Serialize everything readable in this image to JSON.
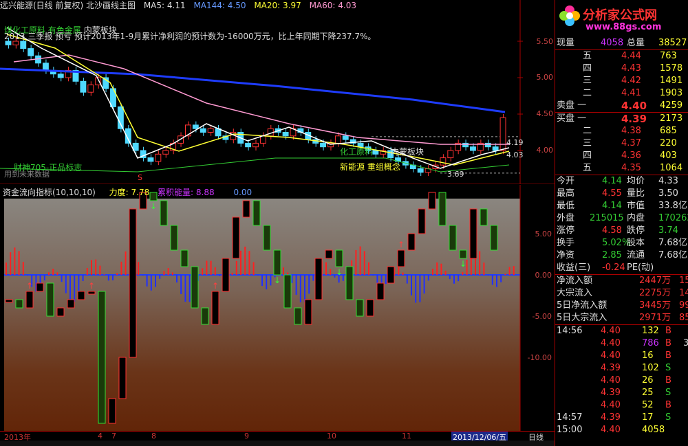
{
  "header": {
    "title": "远兴能源(日线 前复权) 北沙画线主图",
    "ma5": "MA5: 4.11",
    "ma144": "MA144: 4.50",
    "ma20": "MA20: 3.97",
    "ma60": "MA60: 4.03"
  },
  "main_annotations": {
    "notice": "2013 三季报 预亏 预计2013年1-9月累计净利润的预计数为-16000万元，比上年同期下降237.7%。",
    "tag1": "煤化工原料",
    "tag2": "有色金属",
    "tag3": "内蒙板块",
    "caishen": "财神705-正品标志",
    "future": "用到未来数据",
    "mid_tag1": "化工原料",
    "mid_tag2": "内蒙板块",
    "mid_tag3": "新能源 重组概念",
    "high_label": "4.19",
    "low_label": "3.69",
    "last_label": "4.03",
    "s_marker": "S"
  },
  "main_yaxis": [
    "5.50",
    "5.00",
    "4.50",
    "4.00"
  ],
  "indicator": {
    "title": "资金流向指标(10,10,10)",
    "li_du": "力度: 7.78",
    "lei_ji": "累积能量: 8.88",
    "zero": "0.00",
    "yaxis": [
      "5.00",
      "0.00",
      "-5.00",
      "-10.00"
    ]
  },
  "date_bar": {
    "year": "2013年",
    "m4": "4",
    "m7": "7",
    "m8": "8",
    "m9": "9",
    "m10": "10",
    "m11": "11",
    "current_date": "2013/12/06/五",
    "period": "日线"
  },
  "logo": {
    "brand": "分析家公式网",
    "url": "www.88gs.com"
  },
  "quote": {
    "xianliang_label": "现量",
    "xianliang": "4058",
    "zongliang_label": "总量",
    "zongliang": "38527",
    "asks": [
      {
        "label": "五",
        "price": "4.44",
        "vol": "763"
      },
      {
        "label": "四",
        "price": "4.43",
        "vol": "1578"
      },
      {
        "label": "三",
        "price": "4.42",
        "vol": "1491"
      },
      {
        "label": "二",
        "price": "4.41",
        "vol": "1903"
      },
      {
        "label": "卖盘 一",
        "price": "4.40",
        "vol": "4259"
      }
    ],
    "bids": [
      {
        "label": "买盘 一",
        "price": "4.39",
        "vol": "2173"
      },
      {
        "label": "二",
        "price": "4.38",
        "vol": "685"
      },
      {
        "label": "三",
        "price": "4.37",
        "vol": "220"
      },
      {
        "label": "四",
        "price": "4.36",
        "vol": "403"
      },
      {
        "label": "五",
        "price": "4.35",
        "vol": "1064"
      }
    ],
    "stats": [
      {
        "l1": "今开",
        "v1": "4.14",
        "l2": "均价",
        "v2": "4.33"
      },
      {
        "l1": "最高",
        "v1": "4.55",
        "l2": "量比",
        "v2": "3.50"
      },
      {
        "l1": "最低",
        "v1": "4.14",
        "l2": "市值",
        "v2": "33.8亿"
      },
      {
        "l1": "外盘",
        "v1": "215015",
        "l2": "内盘",
        "v2": "170262"
      },
      {
        "l1": "涨停",
        "v1": "4.58",
        "l2": "跌停",
        "v2": "3.74"
      },
      {
        "l1": "换手",
        "v1": "5.02%",
        "l2": "股本",
        "v2": "7.68亿"
      },
      {
        "l1": "净资",
        "v1": "2.85",
        "l2": "流通",
        "v2": "7.68亿"
      },
      {
        "l1": "收益(三)",
        "v1": "-0.24",
        "l2": "PE(动)",
        "v2": ""
      }
    ],
    "flows": [
      {
        "l": "净流入额",
        "v": "2447万",
        "v2": "15"
      },
      {
        "l": "大宗流入",
        "v": "2275万",
        "v2": "14"
      },
      {
        "l": "5日净流入额",
        "v": "3445万",
        "v2": "99"
      },
      {
        "l": "5日大宗流入",
        "v": "2971万",
        "v2": "85"
      }
    ],
    "ticks": [
      {
        "t": "14:56",
        "p": "4.40",
        "v": "132",
        "s": "B",
        "x": ""
      },
      {
        "t": "",
        "p": "4.40",
        "v": "786",
        "s": "B",
        "x": "3"
      },
      {
        "t": "",
        "p": "4.40",
        "v": "16",
        "s": "B",
        "x": ""
      },
      {
        "t": "",
        "p": "4.39",
        "v": "102",
        "s": "S",
        "x": ""
      },
      {
        "t": "",
        "p": "4.40",
        "v": "26",
        "s": "B",
        "x": ""
      },
      {
        "t": "",
        "p": "4.39",
        "v": "25",
        "s": "S",
        "x": ""
      },
      {
        "t": "",
        "p": "4.40",
        "v": "52",
        "s": "B",
        "x": ""
      },
      {
        "t": "14:57",
        "p": "4.39",
        "v": "17",
        "s": "S",
        "x": ""
      },
      {
        "t": "15:00",
        "p": "4.40",
        "v": "4058",
        "s": "",
        "x": ""
      }
    ]
  },
  "colors": {
    "up": "#ff3333",
    "down": "#33cc33",
    "ma144": "#1e3cff",
    "ma5": "#ffffff",
    "ma20": "#ffff33",
    "ma60": "#ff9ad2"
  }
}
